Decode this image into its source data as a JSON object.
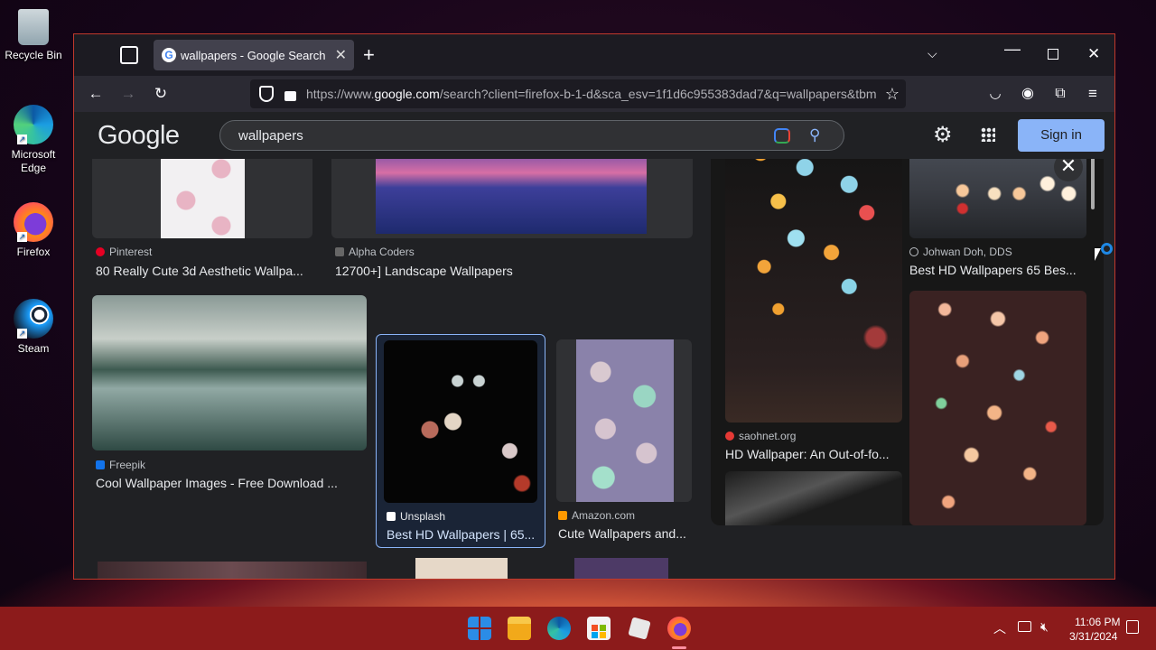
{
  "desktop": {
    "icons": [
      {
        "label": "Recycle Bin",
        "icon": "recycle-bin-icon"
      },
      {
        "label": "Microsoft Edge",
        "icon": "edge-icon"
      },
      {
        "label": "Firefox",
        "icon": "firefox-icon"
      },
      {
        "label": "Steam",
        "icon": "steam-icon"
      }
    ]
  },
  "browser": {
    "tab_title": "wallpapers - Google Search",
    "url_prefix": "https://www.",
    "url_domain": "google.com",
    "url_rest": "/search?client=firefox-b-1-d&sca_esv=1f1d6c955383dad7&q=wallpapers&tbm"
  },
  "google": {
    "logo": "Google",
    "query": "wallpapers",
    "signin_label": "Sign in"
  },
  "results": [
    {
      "source": "Pinterest",
      "title": "80 Really Cute 3d Aesthetic Wallpa...",
      "source_color": "#e60023"
    },
    {
      "source": "Alpha Coders",
      "title": "12700+] Landscape Wallpapers",
      "source_color": "#666666"
    },
    {
      "source": "Freepik",
      "title": "Cool Wallpaper Images - Free Download ...",
      "source_color": "#1273eb"
    },
    {
      "source": "Unsplash",
      "title": "Best HD Wallpapers | 65...",
      "source_color": "#ffffff"
    },
    {
      "source": "Amazon.com",
      "title": "Cute Wallpapers and...",
      "source_color": "#ff9900"
    }
  ],
  "panel": {
    "items": [
      {
        "source": "saohnet.org",
        "title": "HD Wallpaper: An Out-of-fo..."
      },
      {
        "source": "Johwan Doh, DDS",
        "title": "Best HD Wallpapers 65 Bes..."
      }
    ]
  },
  "taskbar": {
    "time": "11:06 PM",
    "date": "3/31/2024"
  },
  "colors": {
    "accent": "#8ab4f8",
    "taskbar": "#8c1b1b",
    "window_border": "#c0392b"
  }
}
